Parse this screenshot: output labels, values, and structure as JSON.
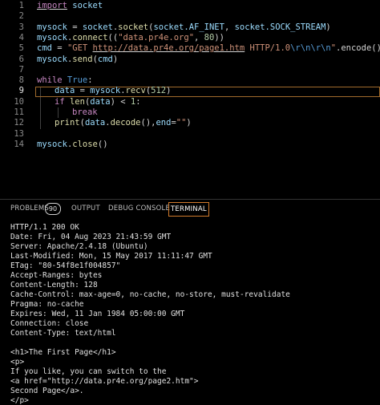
{
  "editor": {
    "line_numbers": [
      "1",
      "2",
      "3",
      "4",
      "5",
      "6",
      "7",
      "8",
      "9",
      "10",
      "11",
      "12",
      "13",
      "14"
    ],
    "lines": {
      "l1_kw": "import",
      "l1_mod": "socket",
      "l3_var": "mysock",
      "l3_eq": " = ",
      "l3_mod": "socket",
      "l3_dot": ".",
      "l3_fn": "socket",
      "l3_open": "(",
      "l3_arg1_mod": "socket",
      "l3_arg1_attr": ".AF_INET",
      "l3_comma": ", ",
      "l3_arg2_mod": "socket",
      "l3_arg2_attr": ".SOCK_STREAM",
      "l3_close": ")",
      "l4_var": "mysock",
      "l4_dot": ".",
      "l4_fn": "connect",
      "l4_open": "((",
      "l4_str": "\"data.pr4e.org\"",
      "l4_comma": ", ",
      "l4_num": "80",
      "l4_close": "))",
      "l5_var": "cmd",
      "l5_eq": " = ",
      "l5_str1": "\"GET ",
      "l5_url": "http://data.pr4e.org/page1.htm",
      "l5_str2": " HTTP/1.0",
      "l5_esc": "\\r\\n\\r\\n",
      "l5_str3": "\"",
      "l5_method": ".encode()",
      "l6_var": "mysock",
      "l6_dot": ".",
      "l6_fn": "send",
      "l6_open": "(",
      "l6_arg": "cmd",
      "l6_close": ")",
      "l8_kw": "while",
      "l8_true": " True",
      "l8_colon": ":",
      "l9_var": "data",
      "l9_eq": " = ",
      "l9_obj": "mysock",
      "l9_dot": ".",
      "l9_fn": "recv",
      "l9_open": "(",
      "l9_num": "512",
      "l9_close": ")",
      "l10_kw": "if",
      "l10_fn": " len",
      "l10_open": "(",
      "l10_arg": "data",
      "l10_close": ")",
      "l10_op": " < ",
      "l10_num": "1",
      "l10_colon": ":",
      "l11_kw": "break",
      "l12_fn": "print",
      "l12_open": "(",
      "l12_arg": "data",
      "l12_dot": ".",
      "l12_fn2": "decode",
      "l12_paren": "(),",
      "l12_kw": "end",
      "l12_eq": "=",
      "l12_str": "\"\"",
      "l12_close": ")",
      "l14_var": "mysock",
      "l14_dot": ".",
      "l14_fn": "close",
      "l14_paren": "()"
    }
  },
  "panel": {
    "tabs": [
      "PROBLEMS",
      "OUTPUT",
      "DEBUG CONSOLE",
      "TERMINAL"
    ],
    "problems_count": "90",
    "active_tab": "TERMINAL"
  },
  "terminal": {
    "lines": [
      "HTTP/1.1 200 OK",
      "Date: Fri, 04 Aug 2023 21:43:59 GMT",
      "Server: Apache/2.4.18 (Ubuntu)",
      "Last-Modified: Mon, 15 May 2017 11:11:47 GMT",
      "ETag: \"80-54f8e1f004857\"",
      "Accept-Ranges: bytes",
      "Content-Length: 128",
      "Cache-Control: max-age=0, no-cache, no-store, must-revalidate",
      "Pragma: no-cache",
      "Expires: Wed, 11 Jan 1984 05:00:00 GMT",
      "Connection: close",
      "Content-Type: text/html",
      "",
      "<h1>The First Page</h1>",
      "<p>",
      "If you like, you can switch to the",
      "<a href=\"http://data.pr4e.org/page2.htm\">",
      "Second Page</a>.",
      "</p>"
    ]
  },
  "colors": {
    "accent": "#d07a2c",
    "background": "#000000"
  }
}
